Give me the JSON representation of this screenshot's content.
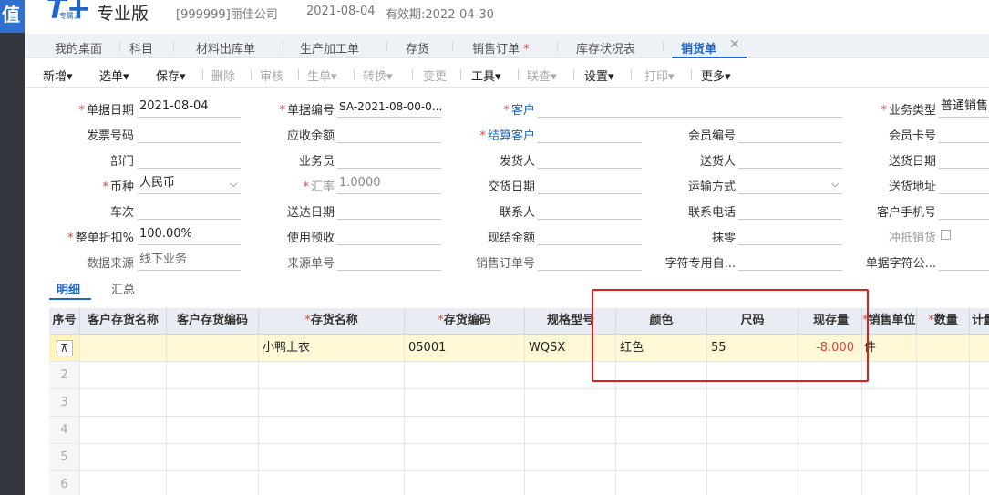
{
  "sidebar": {
    "glyph": "值"
  },
  "header": {
    "logo_big": "T+",
    "logo_small": "专属云",
    "edition": "专业版",
    "company": "[999999]丽佳公司",
    "date": "2021-08-04",
    "validity": "有效期:2022-04-30"
  },
  "tabs": {
    "items": [
      {
        "label": "我的桌面"
      },
      {
        "label": "科目"
      },
      {
        "label": "材料出库单"
      },
      {
        "label": "生产加工单"
      },
      {
        "label": "存货"
      },
      {
        "label": "销售订单",
        "star": "*"
      },
      {
        "label": "库存状况表"
      },
      {
        "label": "销货单"
      }
    ],
    "close": "✕"
  },
  "toolbar": {
    "new": "新增",
    "select": "选单",
    "save": "保存",
    "delete": "删除",
    "audit": "审核",
    "generate": "生单",
    "convert": "转换",
    "change": "变更",
    "tools": "工具",
    "query": "联查",
    "settings": "设置",
    "print": "打印",
    "more": "更多",
    "chevron": "▾"
  },
  "form": {
    "doc_date_label": "单据日期",
    "doc_date": "2021-08-04",
    "doc_no_label": "单据编号",
    "doc_no": "SA-2021-08-00-0...",
    "customer_label": "客户",
    "customer": "",
    "biz_type_label": "业务类型",
    "biz_type": "普通销售",
    "invoice_no_label": "发票号码",
    "invoice_no": "",
    "receivable_label": "应收余额",
    "receivable": "",
    "settle_customer_label": "结算客户",
    "settle_customer": "",
    "member_no_label": "会员编号",
    "member_no": "",
    "member_card_label": "会员卡号",
    "member_card": "",
    "dept_label": "部门",
    "dept": "",
    "salesman_label": "业务员",
    "salesman": "",
    "shipper_label": "发货人",
    "shipper": "",
    "deliverer_label": "送货人",
    "deliverer": "",
    "delivery_date_label": "送货日期",
    "delivery_date": "",
    "currency_label": "币种",
    "currency": "人民币",
    "rate_label": "汇率",
    "rate": "1.0000",
    "handover_date_label": "交货日期",
    "handover_date": "",
    "transport_label": "运输方式",
    "transport": "",
    "delivery_addr_label": "送货地址",
    "delivery_addr": "",
    "train_label": "车次",
    "train": "",
    "arrival_date_label": "送达日期",
    "arrival_date": "",
    "contact_label": "联系人",
    "contact": "",
    "contact_phone_label": "联系电话",
    "contact_phone": "",
    "cust_mobile_label": "客户手机号",
    "cust_mobile": "",
    "discount_label": "整单折扣%",
    "discount": "100.00%",
    "prepay_label": "使用预收",
    "prepay": "",
    "cash_label": "现结金额",
    "cash": "",
    "rounding_label": "抹零",
    "rounding": "",
    "offset_label": "冲抵销货",
    "source_label": "数据来源",
    "source": "线下业务",
    "source_no_label": "来源单号",
    "source_no": "",
    "sales_order_no_label": "销售订单号",
    "sales_order_no": "",
    "char_custom_label": "字符专用自...",
    "char_custom": "",
    "doc_char_label": "单据字符公...",
    "doc_char": ""
  },
  "subtabs": {
    "detail": "明细",
    "summary": "汇总"
  },
  "grid": {
    "headers": {
      "seq": "序号",
      "cust_inv_name": "客户存货名称",
      "cust_inv_code": "客户存货编码",
      "inv_name": "存货名称",
      "inv_code": "存货编码",
      "spec": "规格型号",
      "color": "颜色",
      "size": "尺码",
      "stock": "现存量",
      "unit": "销售单位",
      "qty": "数量",
      "calc": "计量"
    },
    "row1": {
      "icon": "⊼",
      "inv_name": "小鸭上衣",
      "inv_code": "05001",
      "spec": "WQSX",
      "color": "红色",
      "size": "55",
      "stock": "-8.000",
      "unit": "件"
    },
    "row_numbers": [
      "2",
      "3",
      "4",
      "5",
      "6"
    ]
  }
}
